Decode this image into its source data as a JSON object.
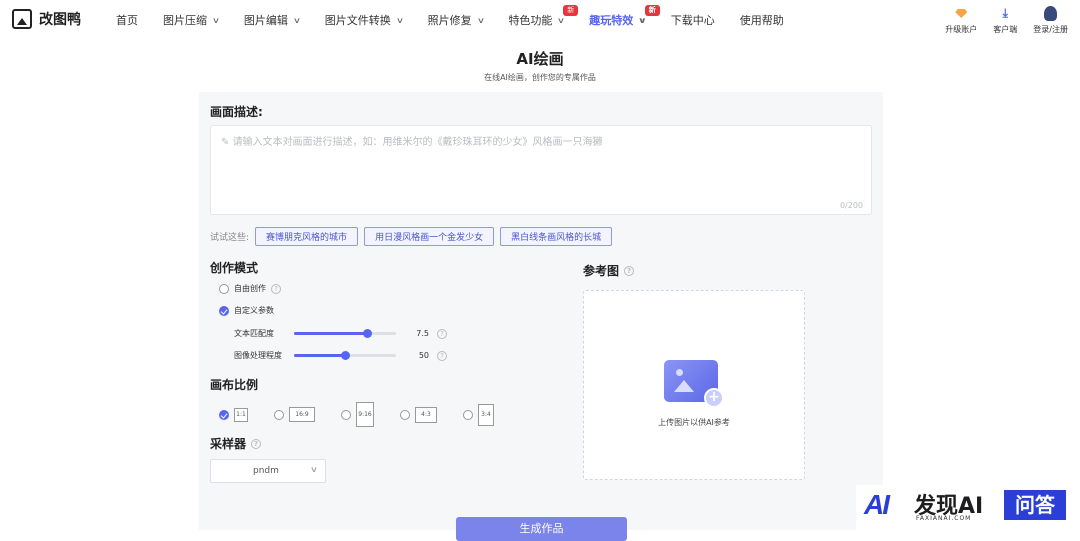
{
  "header": {
    "logo_text": "改图鸭",
    "nav": [
      {
        "label": "首页",
        "dropdown": false
      },
      {
        "label": "图片压缩",
        "dropdown": true
      },
      {
        "label": "图片编辑",
        "dropdown": true
      },
      {
        "label": "图片文件转换",
        "dropdown": true
      },
      {
        "label": "照片修复",
        "dropdown": true
      },
      {
        "label": "特色功能",
        "dropdown": true,
        "badge": "新"
      },
      {
        "label": "趣玩特效",
        "dropdown": true,
        "badge": "新",
        "active": true
      },
      {
        "label": "下载中心",
        "dropdown": false
      },
      {
        "label": "使用帮助",
        "dropdown": false
      }
    ],
    "tools": {
      "upgrade": "升级账户",
      "client": "客户端",
      "login": "登录/注册"
    }
  },
  "page": {
    "title": "AI绘画",
    "subtitle": "在线AI绘画，创作您的专属作品"
  },
  "prompt": {
    "section_title": "画面描述:",
    "placeholder": "请输入文本对画面进行描述，如：用维米尔的《戴珍珠耳环的少女》风格画一只海獭",
    "counter": "0/200",
    "try_label": "试试这些:",
    "suggestions": [
      "赛博朋克风格的城市",
      "用日漫风格画一个金发少女",
      "黑白线条画风格的长城"
    ]
  },
  "mode": {
    "section_title": "创作模式",
    "options": [
      {
        "label": "自由创作",
        "checked": false
      },
      {
        "label": "自定义参数",
        "checked": true
      }
    ],
    "sliders": [
      {
        "label": "文本匹配度",
        "value": "7.5",
        "fraction": 0.72
      },
      {
        "label": "图像处理程度",
        "value": "50",
        "fraction": 0.5
      }
    ]
  },
  "ratio": {
    "section_title": "画布比例",
    "options": [
      {
        "label": "1:1",
        "checked": true
      },
      {
        "label": "16:9",
        "checked": false
      },
      {
        "label": "9:16",
        "checked": false
      },
      {
        "label": "4:3",
        "checked": false
      },
      {
        "label": "3:4",
        "checked": false
      }
    ]
  },
  "sampler": {
    "section_title": "采样器",
    "value": "pndm"
  },
  "reference": {
    "section_title": "参考图",
    "upload_text": "上传图片以供AI参考"
  },
  "generate_label": "生成作品",
  "watermark": {
    "logo": "AI",
    "cn": "发现AI",
    "en": "FAXIANAI.COM",
    "box": "问答"
  },
  "colors": {
    "accent": "#5865f2",
    "badge": "#e5363b"
  }
}
